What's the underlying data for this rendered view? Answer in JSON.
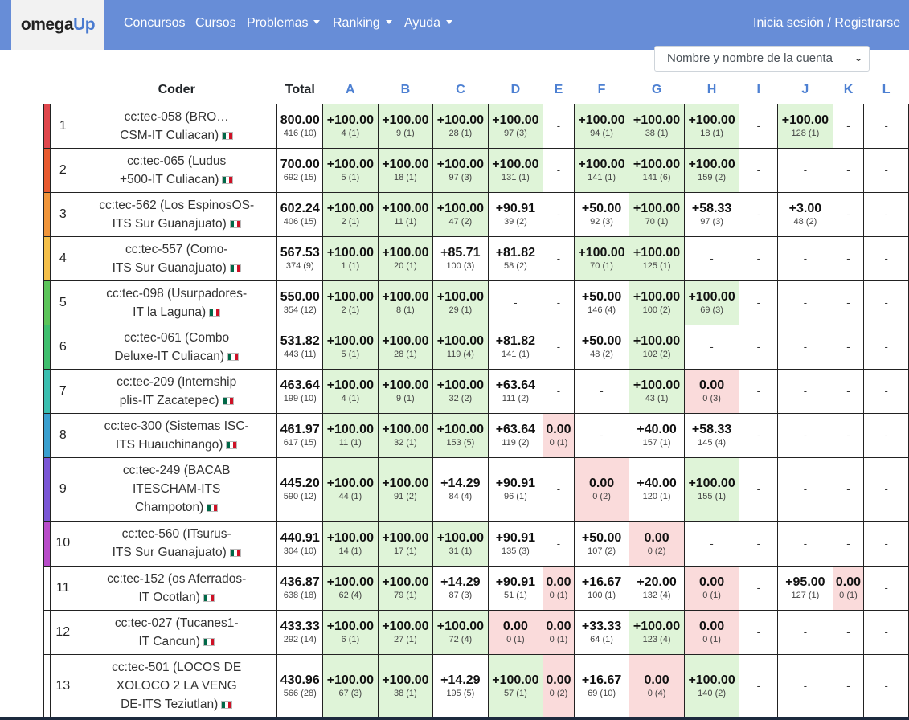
{
  "navbar": {
    "brand_part1": "omega",
    "brand_part2": "Up",
    "items": [
      "Concursos",
      "Cursos",
      "Problemas",
      "Ranking",
      "Ayuda"
    ],
    "login": "Inicia sesión / Registrarse"
  },
  "sort_select": {
    "selected": "Nombre y nombre de la cuenta",
    "icon": "chevron-down-icon"
  },
  "table": {
    "headers": {
      "coder": "Coder",
      "total": "Total"
    },
    "problems": [
      "A",
      "B",
      "C",
      "D",
      "E",
      "F",
      "G",
      "H",
      "I",
      "J",
      "K",
      "L"
    ],
    "rows": [
      {
        "rank": "1",
        "color": "#e0474c",
        "name_line1": "cc:tec-058 (BRO…",
        "name_line2": "CSM-IT Culiacan)",
        "total": "800.00",
        "total_sub": "416 (10)",
        "cells": [
          [
            "+100.00",
            "4 (1)",
            "ok"
          ],
          [
            "+100.00",
            "9 (1)",
            "ok"
          ],
          [
            "+100.00",
            "28 (1)",
            "ok"
          ],
          [
            "+100.00",
            "97 (3)",
            "ok"
          ],
          [
            "-",
            "",
            ""
          ],
          [
            "+100.00",
            "94 (1)",
            "ok"
          ],
          [
            "+100.00",
            "38 (1)",
            "ok"
          ],
          [
            "+100.00",
            "18 (1)",
            "ok"
          ],
          [
            "-",
            "",
            ""
          ],
          [
            "+100.00",
            "128 (1)",
            "ok"
          ],
          [
            "-",
            "",
            ""
          ],
          [
            "-",
            "",
            ""
          ]
        ]
      },
      {
        "rank": "2",
        "color": "#e85a2f",
        "name_line1": "cc:tec-065 (Ludus",
        "name_line2": "+500-IT Culiacan)",
        "total": "700.00",
        "total_sub": "692 (15)",
        "cells": [
          [
            "+100.00",
            "5 (1)",
            "ok"
          ],
          [
            "+100.00",
            "18 (1)",
            "ok"
          ],
          [
            "+100.00",
            "97 (3)",
            "ok"
          ],
          [
            "+100.00",
            "131 (1)",
            "ok"
          ],
          [
            "-",
            "",
            ""
          ],
          [
            "+100.00",
            "141 (1)",
            "ok"
          ],
          [
            "+100.00",
            "141 (6)",
            "ok"
          ],
          [
            "+100.00",
            "159 (2)",
            "ok"
          ],
          [
            "-",
            "",
            ""
          ],
          [
            "-",
            "",
            ""
          ],
          [
            "-",
            "",
            ""
          ],
          [
            "-",
            "",
            ""
          ]
        ]
      },
      {
        "rank": "3",
        "color": "#f0953a",
        "name_line1": "cc:tec-562 (Los EspinosOS-",
        "name_line2": "ITS Sur Guanajuato)",
        "total": "602.24",
        "total_sub": "406 (15)",
        "cells": [
          [
            "+100.00",
            "2 (1)",
            "ok"
          ],
          [
            "+100.00",
            "11 (1)",
            "ok"
          ],
          [
            "+100.00",
            "47 (2)",
            "ok"
          ],
          [
            "+90.91",
            "39 (2)",
            ""
          ],
          [
            "-",
            "",
            ""
          ],
          [
            "+50.00",
            "92 (3)",
            ""
          ],
          [
            "+100.00",
            "70 (1)",
            "ok"
          ],
          [
            "+58.33",
            "97 (3)",
            ""
          ],
          [
            "-",
            "",
            ""
          ],
          [
            "+3.00",
            "48 (2)",
            ""
          ],
          [
            "-",
            "",
            ""
          ],
          [
            "-",
            "",
            ""
          ]
        ]
      },
      {
        "rank": "4",
        "color": "#f5c04a",
        "name_line1": "cc:tec-557 (Como-",
        "name_line2": "ITS Sur Guanajuato)",
        "total": "567.53",
        "total_sub": "374 (9)",
        "cells": [
          [
            "+100.00",
            "1 (1)",
            "ok"
          ],
          [
            "+100.00",
            "20 (1)",
            "ok"
          ],
          [
            "+85.71",
            "100 (3)",
            ""
          ],
          [
            "+81.82",
            "58 (2)",
            ""
          ],
          [
            "-",
            "",
            ""
          ],
          [
            "+100.00",
            "70 (1)",
            "ok"
          ],
          [
            "+100.00",
            "125 (1)",
            "ok"
          ],
          [
            "-",
            "",
            ""
          ],
          [
            "-",
            "",
            ""
          ],
          [
            "-",
            "",
            ""
          ],
          [
            "-",
            "",
            ""
          ],
          [
            "-",
            "",
            ""
          ]
        ]
      },
      {
        "rank": "5",
        "color": "#5cc55a",
        "name_line1": "cc:tec-098 (Usurpadores-",
        "name_line2": "IT la Laguna)",
        "total": "550.00",
        "total_sub": "354 (12)",
        "cells": [
          [
            "+100.00",
            "2 (1)",
            "ok"
          ],
          [
            "+100.00",
            "8 (1)",
            "ok"
          ],
          [
            "+100.00",
            "29 (1)",
            "ok"
          ],
          [
            "-",
            "",
            ""
          ],
          [
            "-",
            "",
            ""
          ],
          [
            "+50.00",
            "146 (4)",
            ""
          ],
          [
            "+100.00",
            "100 (2)",
            "ok"
          ],
          [
            "+100.00",
            "69 (3)",
            "ok"
          ],
          [
            "-",
            "",
            ""
          ],
          [
            "-",
            "",
            ""
          ],
          [
            "-",
            "",
            ""
          ],
          [
            "-",
            "",
            ""
          ]
        ]
      },
      {
        "rank": "6",
        "color": "#3fbf6e",
        "name_line1": "cc:tec-061 (Combo",
        "name_line2": "Deluxe-IT Culiacan)",
        "total": "531.82",
        "total_sub": "443 (11)",
        "cells": [
          [
            "+100.00",
            "5 (1)",
            "ok"
          ],
          [
            "+100.00",
            "28 (1)",
            "ok"
          ],
          [
            "+100.00",
            "119 (4)",
            "ok"
          ],
          [
            "+81.82",
            "141 (1)",
            ""
          ],
          [
            "-",
            "",
            ""
          ],
          [
            "+50.00",
            "48 (2)",
            ""
          ],
          [
            "+100.00",
            "102 (2)",
            "ok"
          ],
          [
            "-",
            "",
            ""
          ],
          [
            "-",
            "",
            ""
          ],
          [
            "-",
            "",
            ""
          ],
          [
            "-",
            "",
            ""
          ],
          [
            "-",
            "",
            ""
          ]
        ]
      },
      {
        "rank": "7",
        "color": "#3bbfb0",
        "name_line1": "cc:tec-209 (Internship",
        "name_line2": "plis-IT Zacatepec)",
        "total": "463.64",
        "total_sub": "199 (10)",
        "cells": [
          [
            "+100.00",
            "4 (1)",
            "ok"
          ],
          [
            "+100.00",
            "9 (1)",
            "ok"
          ],
          [
            "+100.00",
            "32 (2)",
            "ok"
          ],
          [
            "+63.64",
            "111 (2)",
            ""
          ],
          [
            "-",
            "",
            ""
          ],
          [
            "-",
            "",
            ""
          ],
          [
            "+100.00",
            "43 (1)",
            "ok"
          ],
          [
            "0.00",
            "0 (3)",
            "bad"
          ],
          [
            "-",
            "",
            ""
          ],
          [
            "-",
            "",
            ""
          ],
          [
            "-",
            "",
            ""
          ],
          [
            "-",
            "",
            ""
          ]
        ]
      },
      {
        "rank": "8",
        "color": "#3aa0cf",
        "name_line1": "cc:tec-300 (Sistemas ISC-",
        "name_line2": "ITS Huauchinango)",
        "total": "461.97",
        "total_sub": "617 (15)",
        "cells": [
          [
            "+100.00",
            "11 (1)",
            "ok"
          ],
          [
            "+100.00",
            "32 (1)",
            "ok"
          ],
          [
            "+100.00",
            "153 (5)",
            "ok"
          ],
          [
            "+63.64",
            "119 (2)",
            ""
          ],
          [
            "0.00",
            "0 (1)",
            "bad"
          ],
          [
            "-",
            "",
            ""
          ],
          [
            "+40.00",
            "157 (1)",
            ""
          ],
          [
            "+58.33",
            "145 (4)",
            ""
          ],
          [
            "-",
            "",
            ""
          ],
          [
            "-",
            "",
            ""
          ],
          [
            "-",
            "",
            ""
          ],
          [
            "-",
            "",
            ""
          ]
        ]
      },
      {
        "rank": "9",
        "color": "#7b57d6",
        "name_line1": "cc:tec-249 (BACAB",
        "name_line2": "ITESCHAM-ITS",
        "name_line3": "Champoton)",
        "total": "445.20",
        "total_sub": "590 (12)",
        "cells": [
          [
            "+100.00",
            "44 (1)",
            "ok"
          ],
          [
            "+100.00",
            "91 (2)",
            "ok"
          ],
          [
            "+14.29",
            "84 (4)",
            ""
          ],
          [
            "+90.91",
            "96 (1)",
            ""
          ],
          [
            "-",
            "",
            ""
          ],
          [
            "0.00",
            "0 (2)",
            "bad"
          ],
          [
            "+40.00",
            "120 (1)",
            ""
          ],
          [
            "+100.00",
            "155 (1)",
            "ok"
          ],
          [
            "-",
            "",
            ""
          ],
          [
            "-",
            "",
            ""
          ],
          [
            "-",
            "",
            ""
          ],
          [
            "-",
            "",
            ""
          ]
        ]
      },
      {
        "rank": "10",
        "color": "#b84cc9",
        "name_line1": "cc:tec-560 (ITsurus-",
        "name_line2": "ITS Sur Guanajuato)",
        "total": "440.91",
        "total_sub": "304 (10)",
        "cells": [
          [
            "+100.00",
            "14 (1)",
            "ok"
          ],
          [
            "+100.00",
            "17 (1)",
            "ok"
          ],
          [
            "+100.00",
            "31 (1)",
            "ok"
          ],
          [
            "+90.91",
            "135 (3)",
            ""
          ],
          [
            "-",
            "",
            ""
          ],
          [
            "+50.00",
            "107 (2)",
            ""
          ],
          [
            "0.00",
            "0 (2)",
            "bad"
          ],
          [
            "-",
            "",
            ""
          ],
          [
            "-",
            "",
            ""
          ],
          [
            "-",
            "",
            ""
          ],
          [
            "-",
            "",
            ""
          ],
          [
            "-",
            "",
            ""
          ]
        ]
      },
      {
        "rank": "11",
        "color": "#ffffff",
        "name_line1": "cc:tec-152 (os Aferrados-",
        "name_line2": "IT Ocotlan)",
        "total": "436.87",
        "total_sub": "638 (18)",
        "cells": [
          [
            "+100.00",
            "62 (4)",
            "ok"
          ],
          [
            "+100.00",
            "79 (1)",
            "ok"
          ],
          [
            "+14.29",
            "87 (3)",
            ""
          ],
          [
            "+90.91",
            "51 (1)",
            ""
          ],
          [
            "0.00",
            "0 (1)",
            "bad"
          ],
          [
            "+16.67",
            "100 (1)",
            ""
          ],
          [
            "+20.00",
            "132 (4)",
            ""
          ],
          [
            "0.00",
            "0 (1)",
            "bad"
          ],
          [
            "-",
            "",
            ""
          ],
          [
            "+95.00",
            "127 (1)",
            ""
          ],
          [
            "0.00",
            "0 (1)",
            "bad"
          ],
          [
            "-",
            "",
            ""
          ]
        ]
      },
      {
        "rank": "12",
        "color": "#ffffff",
        "name_line1": "cc:tec-027 (Tucanes1-",
        "name_line2": "IT Cancun)",
        "total": "433.33",
        "total_sub": "292 (14)",
        "cells": [
          [
            "+100.00",
            "6 (1)",
            "ok"
          ],
          [
            "+100.00",
            "27 (1)",
            "ok"
          ],
          [
            "+100.00",
            "72 (4)",
            "ok"
          ],
          [
            "0.00",
            "0 (1)",
            "bad"
          ],
          [
            "0.00",
            "0 (1)",
            "bad"
          ],
          [
            "+33.33",
            "64 (1)",
            ""
          ],
          [
            "+100.00",
            "123 (4)",
            "ok"
          ],
          [
            "0.00",
            "0 (1)",
            "bad"
          ],
          [
            "-",
            "",
            ""
          ],
          [
            "-",
            "",
            ""
          ],
          [
            "-",
            "",
            ""
          ],
          [
            "-",
            "",
            ""
          ]
        ]
      },
      {
        "rank": "13",
        "color": "#ffffff",
        "name_line1": "cc:tec-501 (LOCOS DE",
        "name_line2": "XOLOCO 2 LA VENG",
        "name_line3": "DE-ITS Teziutlan)",
        "total": "430.96",
        "total_sub": "566 (28)",
        "cells": [
          [
            "+100.00",
            "67 (3)",
            "ok"
          ],
          [
            "+100.00",
            "38 (1)",
            "ok"
          ],
          [
            "+14.29",
            "195 (5)",
            ""
          ],
          [
            "+100.00",
            "57 (1)",
            "ok"
          ],
          [
            "0.00",
            "0 (2)",
            "bad"
          ],
          [
            "+16.67",
            "69 (10)",
            ""
          ],
          [
            "0.00",
            "0 (4)",
            "bad"
          ],
          [
            "+100.00",
            "140 (2)",
            "ok"
          ],
          [
            "-",
            "",
            ""
          ],
          [
            "-",
            "",
            ""
          ],
          [
            "-",
            "",
            ""
          ],
          [
            "-",
            "",
            ""
          ]
        ]
      }
    ]
  }
}
